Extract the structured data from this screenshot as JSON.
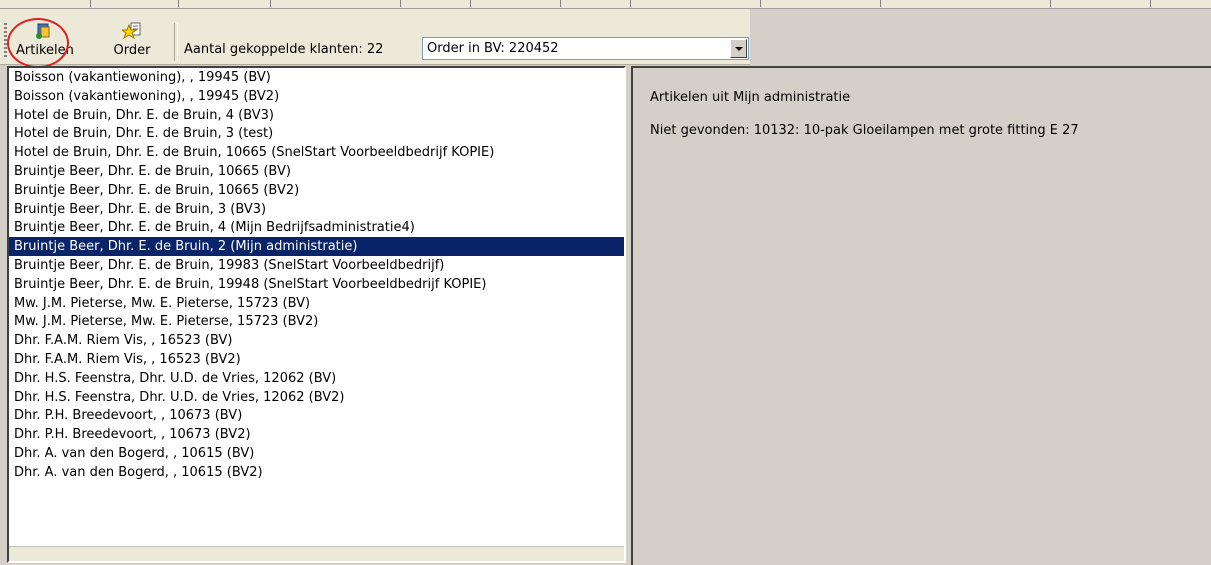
{
  "toolbar": {
    "artikelen_label": "Artikelen",
    "order_label": "Order",
    "klanten_label": "Aantal gekoppelde klanten: 22",
    "order_combo_value": "Order in BV: 220452"
  },
  "list": {
    "items": [
      "Boisson (vakantiewoning), , 19945 (BV)",
      "Boisson (vakantiewoning), , 19945 (BV2)",
      "Hotel de Bruin, Dhr. E. de Bruin, 4 (BV3)",
      "Hotel de Bruin, Dhr. E. de Bruin, 3 (test)",
      "Hotel de Bruin, Dhr. E. de Bruin, 10665 (SnelStart Voorbeeldbedrijf KOPIE)",
      "Bruintje Beer, Dhr. E. de Bruin, 10665 (BV)",
      "Bruintje Beer, Dhr. E. de Bruin, 10665 (BV2)",
      "Bruintje Beer, Dhr. E. de Bruin, 3 (BV3)",
      "Bruintje Beer, Dhr. E. de Bruin, 4 (Mijn Bedrijfsadministratie4)",
      "Bruintje Beer, Dhr. E. de Bruin, 2 (Mijn administratie)",
      "Bruintje Beer, Dhr. E. de Bruin, 19983 (SnelStart Voorbeeldbedrijf)",
      "Bruintje Beer, Dhr. E. de Bruin, 19948 (SnelStart Voorbeeldbedrijf KOPIE)",
      "Mw. J.M. Pieterse, Mw. E. Pieterse, 15723 (BV)",
      "Mw. J.M. Pieterse, Mw. E. Pieterse, 15723 (BV2)",
      "Dhr. F.A.M. Riem Vis, , 16523 (BV)",
      "Dhr. F.A.M. Riem Vis, , 16523 (BV2)",
      "Dhr. H.S. Feenstra, Dhr. U.D. de Vries, 12062 (BV)",
      "Dhr. H.S. Feenstra, Dhr. U.D. de Vries, 12062 (BV2)",
      "Dhr. P.H. Breedevoort, , 10673 (BV)",
      "Dhr. P.H. Breedevoort, , 10673 (BV2)",
      "Dhr. A. van den Bogerd, , 10615 (BV)",
      "Dhr. A. van den Bogerd, , 10615 (BV2)"
    ]
  },
  "detail": {
    "heading": "Artikelen uit Mijn administratie",
    "message": "Niet gevonden: 10132: 10-pak Gloeilampen met grote fitting E 27"
  },
  "colors": {
    "selection": "#0a246a",
    "annotation": "#e02020",
    "panel": "#d4d0c8"
  }
}
